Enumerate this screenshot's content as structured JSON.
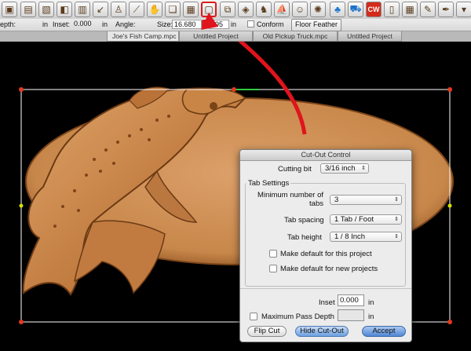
{
  "toolbar": {
    "icons": [
      "box-icon",
      "book-icon",
      "page-icon",
      "tool-icon",
      "thin-line-icon",
      "curve-icon",
      "figure-icon",
      "knife-icon",
      "hand-icon",
      "layers-icon",
      "text-icon",
      "book2-icon",
      "cutout-icon",
      "duplicate-icon",
      "gem-icon",
      "horse-icon",
      "boat-icon",
      "face-icon",
      "globe-icon",
      "tree-icon",
      "cart-icon",
      "cw-icon",
      "page2-icon",
      "grid-icon",
      "sign-icon",
      "pen-icon",
      "dropdown-icon"
    ]
  },
  "optbar": {
    "depth_label": "epth:",
    "in_label": "in",
    "inset_label": "Inset:",
    "inset_value": "0.000",
    "inset_unit": "in",
    "angle_label": "Angle:",
    "size_label": "Size:",
    "size_value": "16.680",
    "size2_value": "195",
    "size_unit": "in",
    "conform_label": "Conform",
    "floor_feather_label": "Floor Feather"
  },
  "tabs": [
    "Joe's Fish Camp.mpc",
    "Untitled Project",
    "Old Pickup Truck.mpc",
    "Untitled Project"
  ],
  "dialog": {
    "title": "Cut-Out Control",
    "cutting_bit_label": "Cutting bit",
    "cutting_bit_value": "3/16 inch",
    "tab_settings_label": "Tab Settings",
    "min_tabs_label_1": "Minimum number of",
    "min_tabs_label_2": "tabs",
    "min_tabs_value": "3",
    "tab_spacing_label": "Tab spacing",
    "tab_spacing_value": "1 Tab / Foot",
    "tab_height_label": "Tab height",
    "tab_height_value": "1 / 8 Inch",
    "default_project_label": "Make default for this project",
    "default_new_label": "Make default for new projects",
    "inset_label": "Inset",
    "inset_value": "0.000",
    "inset_unit": "in",
    "max_pass_label": "Maximum Pass Depth",
    "max_pass_unit": "in",
    "flip_cut_label": "Flip Cut",
    "hide_cutout_label": "Hide Cut-Out",
    "accept_label": "Accept"
  },
  "colors": {
    "oval": "#c8874a",
    "fish": "#c07a3e",
    "arrow": "#e0141c",
    "bbox": "#ffffff",
    "handle": "#e33a1f"
  }
}
